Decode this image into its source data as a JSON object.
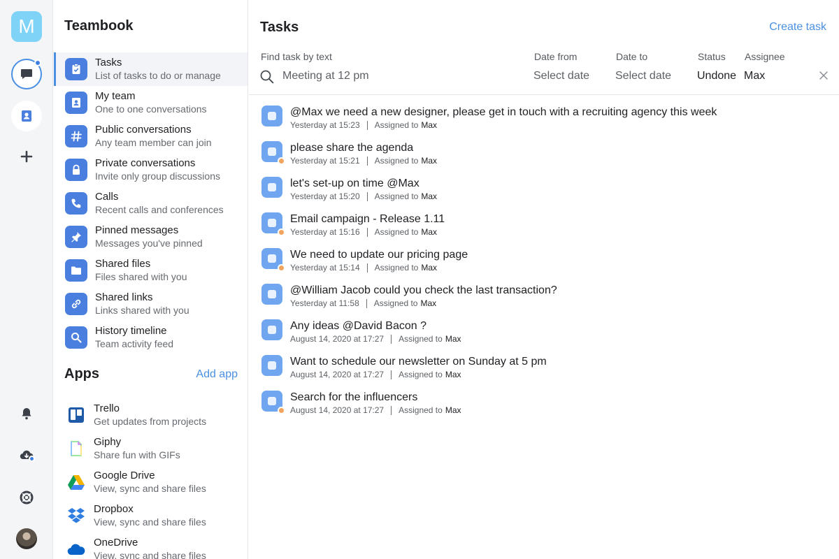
{
  "rail": {
    "workspace_letter": "M",
    "colors": {
      "workspace": "#7fd3f7",
      "accent": "#4a90e2",
      "badge": "#3d7fe0"
    },
    "icons": [
      "chat-icon",
      "contacts-icon",
      "plus-icon",
      "bell-icon",
      "cloud-download-icon",
      "lifebuoy-icon",
      "avatar"
    ]
  },
  "sidebar": {
    "title": "Teambook",
    "items": [
      {
        "label": "Tasks",
        "sub": "List of tasks to do or manage",
        "icon": "clipboard-check-icon"
      },
      {
        "label": "My team",
        "sub": "One to one conversations",
        "icon": "contacts-icon"
      },
      {
        "label": "Public conversations",
        "sub": "Any team member can join",
        "icon": "hash-icon"
      },
      {
        "label": "Private conversations",
        "sub": "Invite only group discussions",
        "icon": "lock-icon"
      },
      {
        "label": "Calls",
        "sub": "Recent calls and conferences",
        "icon": "phone-icon"
      },
      {
        "label": "Pinned messages",
        "sub": "Messages you've pinned",
        "icon": "pin-icon"
      },
      {
        "label": "Shared files",
        "sub": "Files shared with you",
        "icon": "folder-icon"
      },
      {
        "label": "Shared links",
        "sub": "Links shared with you",
        "icon": "link-icon"
      },
      {
        "label": "History timeline",
        "sub": "Team activity feed",
        "icon": "search-icon"
      }
    ],
    "apps_title": "Apps",
    "add_app": "Add app",
    "apps": [
      {
        "label": "Trello",
        "sub": "Get updates from projects",
        "icon": "trello-icon"
      },
      {
        "label": "Giphy",
        "sub": "Share fun with GIFs",
        "icon": "giphy-icon"
      },
      {
        "label": "Google Drive",
        "sub": "View, sync and share files",
        "icon": "google-drive-icon"
      },
      {
        "label": "Dropbox",
        "sub": "View, sync and share files",
        "icon": "dropbox-icon"
      },
      {
        "label": "OneDrive",
        "sub": "View, sync and share files",
        "icon": "onedrive-icon"
      }
    ]
  },
  "main": {
    "title": "Tasks",
    "create_task": "Create task",
    "filters": {
      "search_label": "Find task by text",
      "search_value": "Meeting at 12 pm",
      "date_from_label": "Date from",
      "date_from_value": "Select date",
      "date_to_label": "Date to",
      "date_to_value": "Select date",
      "status_label": "Status",
      "status_value": "Undone",
      "assignee_label": "Assignee",
      "assignee_value": "Max"
    },
    "assigned_label": "Assigned to",
    "tasks": [
      {
        "title": "@Max we need a new designer, please get in touch with a recruiting agency this week",
        "time": "Yesterday at 15:23",
        "assignee": "Max",
        "locked": false
      },
      {
        "title": "please share the agenda",
        "time": "Yesterday at 15:21",
        "assignee": "Max",
        "locked": true
      },
      {
        "title": "let's set-up on time @Max",
        "time": "Yesterday at 15:20",
        "assignee": "Max",
        "locked": false
      },
      {
        "title": "Email campaign - Release 1.11",
        "time": "Yesterday at 15:16",
        "assignee": "Max",
        "locked": true
      },
      {
        "title": "We need to update our pricing page",
        "time": "Yesterday at 15:14",
        "assignee": "Max",
        "locked": true
      },
      {
        "title": "@William Jacob could you check the last transaction?",
        "time": "Yesterday at 11:58",
        "assignee": "Max",
        "locked": false
      },
      {
        "title": "Any ideas @David Bacon ?",
        "time": "August 14, 2020 at 17:27",
        "assignee": "Max",
        "locked": false
      },
      {
        "title": "Want to schedule our newsletter on Sunday at 5 pm",
        "time": "August 14, 2020 at 17:27",
        "assignee": "Max",
        "locked": false
      },
      {
        "title": "Search for the influencers",
        "time": "August 14, 2020 at 17:27",
        "assignee": "Max",
        "locked": true
      }
    ]
  }
}
